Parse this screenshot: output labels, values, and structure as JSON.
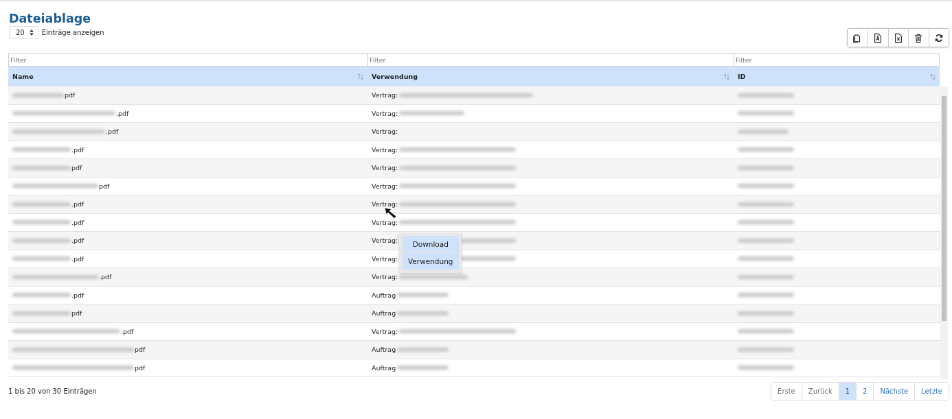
{
  "title": "Dateiablage",
  "page_length": {
    "value": "20",
    "label": "Einträge anzeigen"
  },
  "toolbar_buttons": [
    {
      "kind": "copy"
    },
    {
      "kind": "pdf"
    },
    {
      "kind": "excel"
    },
    {
      "kind": "delete"
    },
    {
      "kind": "refresh"
    }
  ],
  "table": {
    "columns": [
      {
        "name": "Name",
        "filter_placeholder": "Filter"
      },
      {
        "name": "Verwendung",
        "filter_placeholder": "Filter"
      },
      {
        "name": "ID",
        "filter_placeholder": "Filter"
      }
    ],
    "rows": [
      {
        "name": "pdf",
        "usage": "Vertrag:"
      },
      {
        "name": ".pdf",
        "usage": "Vertrag:"
      },
      {
        "name": ".pdf",
        "usage": "Vertrag:"
      },
      {
        "name": ".pdf",
        "usage": "Vertrag:"
      },
      {
        "name": "pdf",
        "usage": "Vertrag:"
      },
      {
        "name": "pdf",
        "usage": "Vertrag:"
      },
      {
        "name": ".pdf",
        "usage": "Vertrag:"
      },
      {
        "name": ".pdf",
        "usage": "Vertrag:"
      },
      {
        "name": ".pdf",
        "usage": "Vertrag:"
      },
      {
        "name": ".pdf",
        "usage": "Vertrag:"
      },
      {
        "name": ".pdf",
        "usage": "Vertrag:"
      },
      {
        "name": ".pdf",
        "usage": "Auftrag"
      },
      {
        "name": "pdf",
        "usage": "Auftrag"
      },
      {
        "name": ".pdf",
        "usage": "Vertrag:"
      },
      {
        "name": "pdf",
        "usage": "Auftrag"
      },
      {
        "name": "pdf",
        "usage": "Auftrag"
      }
    ]
  },
  "context_menu": {
    "items": [
      "Download",
      "Verwendung"
    ]
  },
  "info": "1 bis 20 von 30 Einträgen",
  "pagination": [
    {
      "label": "Erste",
      "selected": false,
      "disabled": true
    },
    {
      "label": "Zurück",
      "selected": false,
      "disabled": true
    },
    {
      "label": "1",
      "selected": true,
      "disabled": false
    },
    {
      "label": "2",
      "selected": false,
      "disabled": false
    },
    {
      "label": "Nächste",
      "selected": false,
      "disabled": false
    },
    {
      "label": "Letzte",
      "selected": false,
      "disabled": false
    }
  ]
}
